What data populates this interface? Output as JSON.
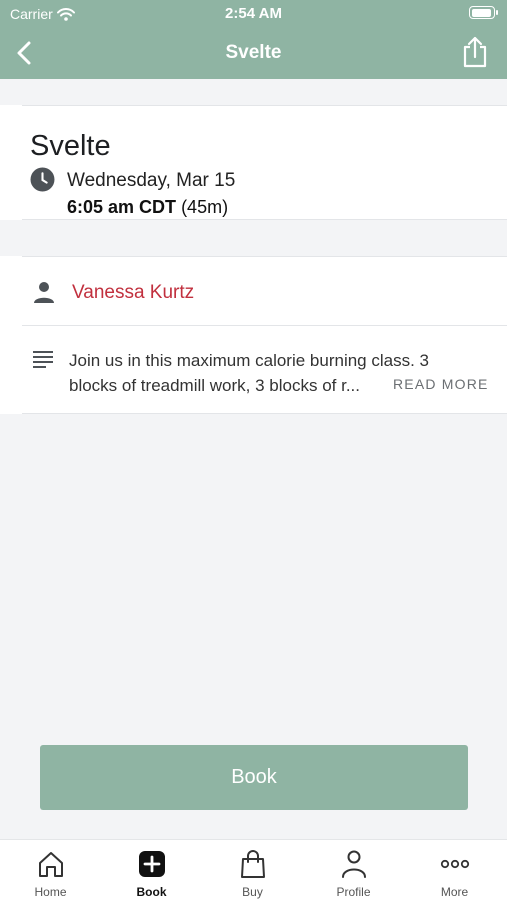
{
  "status_bar": {
    "carrier": "Carrier",
    "time": "2:54 AM"
  },
  "nav": {
    "title": "Svelte"
  },
  "class_info": {
    "name": "Svelte",
    "date": "Wednesday, Mar 15",
    "time": "6:05 am CDT",
    "duration": "(45m)"
  },
  "instructor": {
    "name": "Vanessa Kurtz"
  },
  "description": {
    "line1": "Join us in this maximum calorie burning class. 3",
    "line2": "blocks of treadmill work, 3 blocks of r...",
    "read_more": "READ MORE"
  },
  "book_button": {
    "label": "Book"
  },
  "tabs": [
    {
      "label": "Home",
      "icon": "home-icon"
    },
    {
      "label": "Book",
      "icon": "plus-square-icon",
      "active": true
    },
    {
      "label": "Buy",
      "icon": "bag-icon"
    },
    {
      "label": "Profile",
      "icon": "person-icon"
    },
    {
      "label": "More",
      "icon": "more-icon"
    }
  ],
  "colors": {
    "brand": "#8fb4a3",
    "instructor": "#c1303e",
    "background": "#f3f4f6"
  }
}
